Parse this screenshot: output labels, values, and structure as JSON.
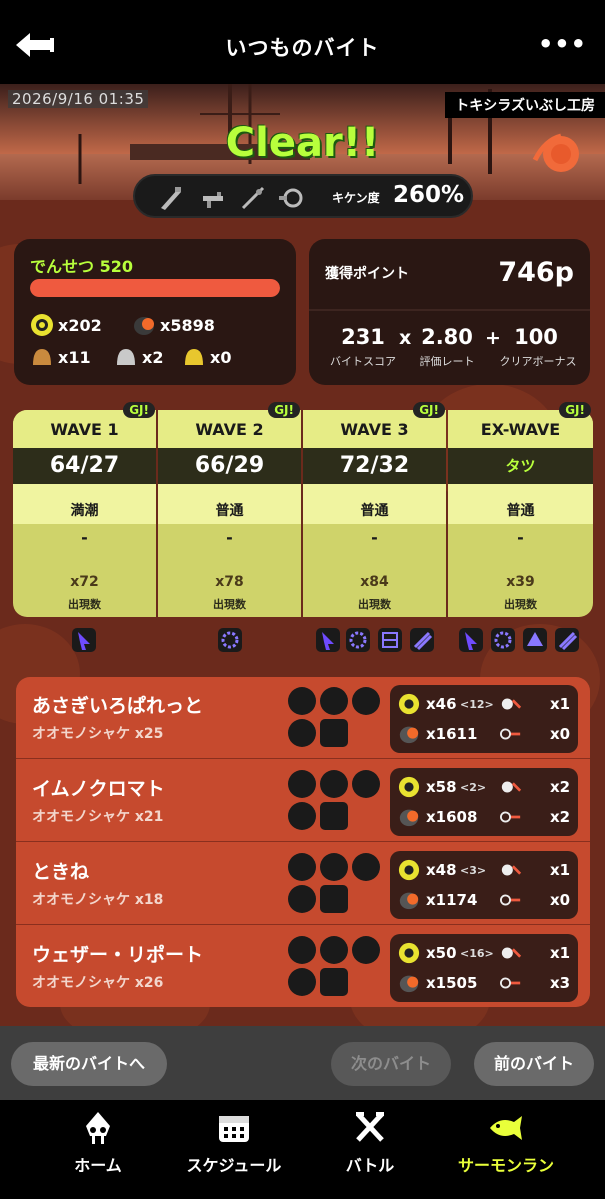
{
  "header": {
    "title": "いつものバイト",
    "back_icon": "back-arrow-icon",
    "more_label": "•••"
  },
  "banner": {
    "datetime": "2026/9/16 01:35",
    "stage": "トキシラズいぶし工房",
    "result": "Clear!!",
    "danger_label": "キケン度",
    "danger_value": "260%"
  },
  "rank": {
    "title": "でんせつ 520",
    "progress": 1.0,
    "golden_eggs": "x202",
    "power_eggs": "x5898",
    "bronze": "x11",
    "silver": "x2",
    "gold": "x0"
  },
  "points": {
    "label": "獲得ポイント",
    "value": "746p",
    "score": "231",
    "score_label": "バイトスコア",
    "rate": "2.80",
    "rate_label": "評価レート",
    "bonus": "100",
    "bonus_label": "クリアボーナス",
    "times": "x",
    "plus": "+"
  },
  "waves": [
    {
      "name": "WAVE 1",
      "score": "64/27",
      "tide": "満潮",
      "event": "-",
      "eggs": "x72",
      "eggs_label": "出現数",
      "badge": "GJ!"
    },
    {
      "name": "WAVE 2",
      "score": "66/29",
      "tide": "普通",
      "event": "-",
      "eggs": "x78",
      "eggs_label": "出現数",
      "badge": "GJ!"
    },
    {
      "name": "WAVE 3",
      "score": "72/32",
      "tide": "普通",
      "event": "-",
      "eggs": "x84",
      "eggs_label": "出現数",
      "badge": "GJ!"
    },
    {
      "name": "EX-WAVE",
      "score": "タツ",
      "tide": "普通",
      "event": "-",
      "eggs": "x39",
      "eggs_label": "出現数",
      "badge": "GJ!"
    }
  ],
  "players": [
    {
      "name": "あさぎいろぱれっと",
      "boss": "オオモノシャケ x25",
      "golden": "x46",
      "assist": "<12>",
      "power": "x1611",
      "rescues": "x1",
      "deaths": "x0"
    },
    {
      "name": "イムノクロマト",
      "boss": "オオモノシャケ x21",
      "golden": "x58",
      "assist": "<2>",
      "power": "x1608",
      "rescues": "x2",
      "deaths": "x2"
    },
    {
      "name": "ときね",
      "boss": "オオモノシャケ x18",
      "golden": "x48",
      "assist": "<3>",
      "power": "x1174",
      "rescues": "x1",
      "deaths": "x0"
    },
    {
      "name": "ウェザー・リポート",
      "boss": "オオモノシャケ x26",
      "golden": "x50",
      "assist": "<16>",
      "power": "x1505",
      "rescues": "x1",
      "deaths": "x3"
    }
  ],
  "buttons": {
    "latest": "最新のバイトへ",
    "next": "次のバイト",
    "prev": "前のバイト"
  },
  "tabs": [
    {
      "label": "ホーム",
      "icon": "squid-icon"
    },
    {
      "label": "スケジュール",
      "icon": "calendar-icon"
    },
    {
      "label": "バトル",
      "icon": "crossed-weapons-icon"
    },
    {
      "label": "サーモンラン",
      "icon": "salmon-icon"
    }
  ],
  "colors": {
    "accent_green": "#b8ff3c",
    "rank_bar": "#ef5a3f",
    "wave_bg": "#cfd36a",
    "player_bg": "#c64a2e",
    "active_tab": "#e9ff3a"
  }
}
